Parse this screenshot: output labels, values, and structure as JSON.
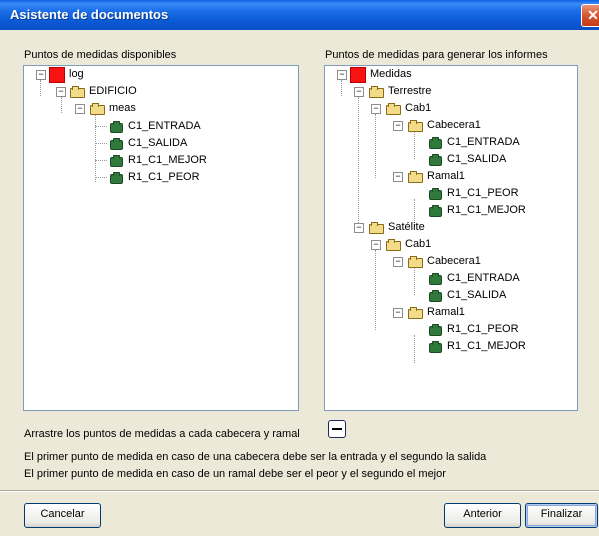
{
  "window": {
    "title": "Asistente de documentos",
    "close_glyph": "✕"
  },
  "left": {
    "label": "Puntos de medidas disponibles",
    "nodes": [
      {
        "text": "log",
        "icon": "red-square-icon"
      },
      {
        "text": "EDIFICIO",
        "icon": "folder-open-icon"
      },
      {
        "text": "meas",
        "icon": "folder-open-icon"
      },
      {
        "text": "C1_ENTRADA",
        "icon": "measure-point-icon"
      },
      {
        "text": "C1_SALIDA",
        "icon": "measure-point-icon"
      },
      {
        "text": "R1_C1_MEJOR",
        "icon": "measure-point-icon"
      },
      {
        "text": "R1_C1_PEOR",
        "icon": "measure-point-icon"
      }
    ]
  },
  "right": {
    "label": "Puntos de medidas para generar los informes",
    "nodes": [
      {
        "text": "Medidas",
        "icon": "red-square-icon"
      },
      {
        "text": "Terrestre",
        "icon": "folder-open-icon"
      },
      {
        "text": "Cab1",
        "icon": "folder-open-icon"
      },
      {
        "text": "Cabecera1",
        "icon": "folder-open-icon"
      },
      {
        "text": "C1_ENTRADA",
        "icon": "measure-point-icon"
      },
      {
        "text": "C1_SALIDA",
        "icon": "measure-point-icon"
      },
      {
        "text": "Ramal1",
        "icon": "folder-open-icon"
      },
      {
        "text": "R1_C1_PEOR",
        "icon": "measure-point-icon"
      },
      {
        "text": "R1_C1_MEJOR",
        "icon": "measure-point-icon"
      },
      {
        "text": "Satélite",
        "icon": "folder-open-icon"
      },
      {
        "text": "Cab1",
        "icon": "folder-open-icon"
      },
      {
        "text": "Cabecera1",
        "icon": "folder-open-icon"
      },
      {
        "text": "C1_ENTRADA",
        "icon": "measure-point-icon"
      },
      {
        "text": "C1_SALIDA",
        "icon": "measure-point-icon"
      },
      {
        "text": "Ramal1",
        "icon": "folder-open-icon"
      },
      {
        "text": "R1_C1_PEOR",
        "icon": "measure-point-icon"
      },
      {
        "text": "R1_C1_MEJOR",
        "icon": "measure-point-icon"
      }
    ]
  },
  "instructions": {
    "drag_hint": "Arrastre los puntos de medidas a cada cabecera y ramal",
    "line1": "El primer punto de medida en caso de una cabecera debe ser la entrada y el segundo la salida",
    "line2": "El primer punto de medida en caso de un ramal debe ser el peor y el segundo el mejor"
  },
  "buttons": {
    "cancel": "Cancelar",
    "back": "Anterior",
    "finish": "Finalizar"
  },
  "colors": {
    "title_bar": "#0c5ad6",
    "dialog_bg": "#ece9d8",
    "root_icon": "#f81212",
    "leaf_icon": "#2f7a3b"
  }
}
